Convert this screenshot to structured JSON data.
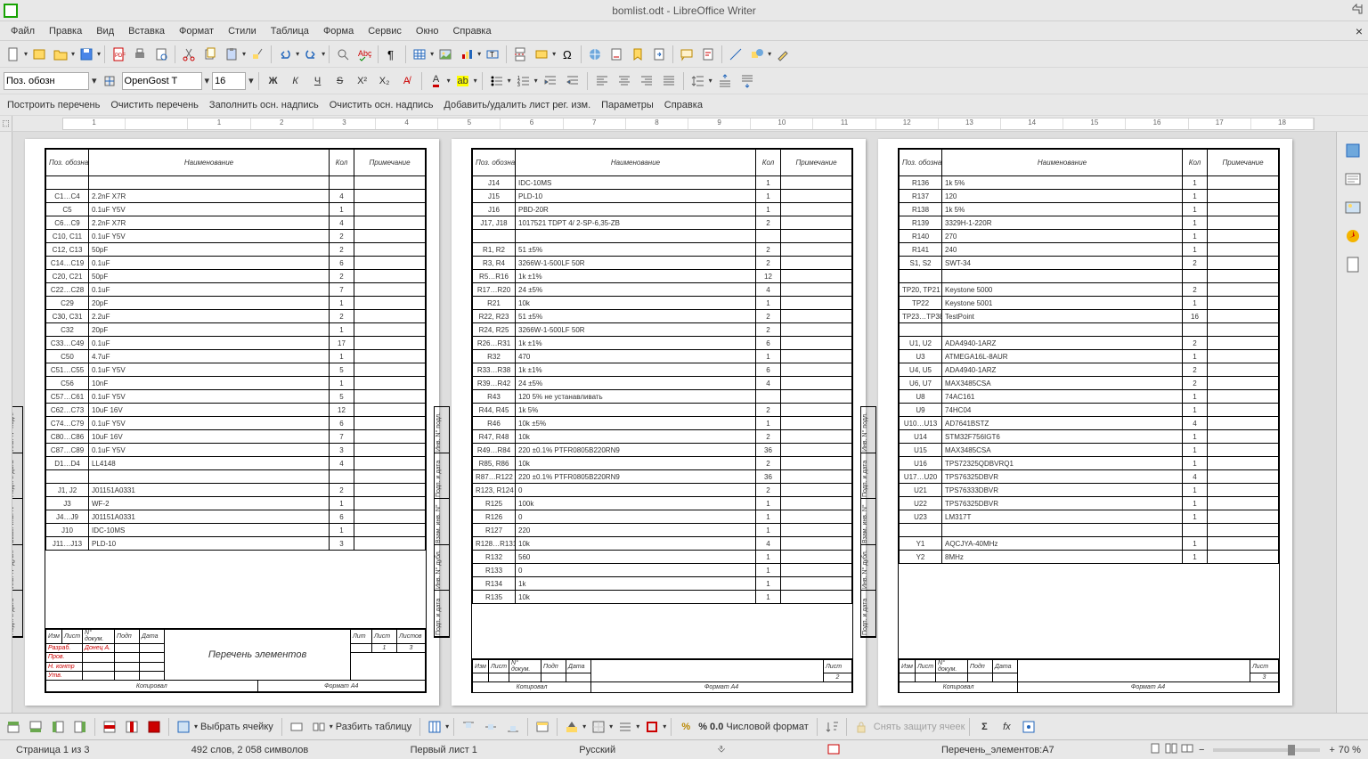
{
  "window": {
    "title": "bomlist.odt - LibreOffice Writer"
  },
  "menu": [
    "Файл",
    "Правка",
    "Вид",
    "Вставка",
    "Формат",
    "Стили",
    "Таблица",
    "Форма",
    "Сервис",
    "Окно",
    "Справка"
  ],
  "fmt": {
    "paraStyle": "Поз. обозн",
    "font": "OpenGost T",
    "size": "16"
  },
  "custom": [
    "Построить перечень",
    "Очистить перечень",
    "Заполнить осн. надпись",
    "Очистить осн. надпись",
    "Добавить/удалить лист рег. изм.",
    "Параметры",
    "Справка"
  ],
  "ruler": [
    "1",
    "",
    "1",
    "2",
    "3",
    "4",
    "5",
    "6",
    "7",
    "8",
    "9",
    "10",
    "11",
    "12",
    "13",
    "14",
    "15",
    "16",
    "17",
    "18"
  ],
  "headers": {
    "pos": "Поз. обозна-чение",
    "name": "Наименование",
    "qty": "Кол",
    "note": "Примечание"
  },
  "page1": [
    [
      "",
      "",
      "",
      ""
    ],
    [
      "C1…C4",
      "2.2nF X7R",
      "4",
      ""
    ],
    [
      "C5",
      "0.1uF Y5V",
      "1",
      ""
    ],
    [
      "C6…C9",
      "2.2nF X7R",
      "4",
      ""
    ],
    [
      "C10, C11",
      "0.1uF Y5V",
      "2",
      ""
    ],
    [
      "C12, C13",
      "50pF",
      "2",
      ""
    ],
    [
      "C14…C19",
      "0.1uF",
      "6",
      ""
    ],
    [
      "C20, C21",
      "50pF",
      "2",
      ""
    ],
    [
      "C22…C28",
      "0.1uF",
      "7",
      ""
    ],
    [
      "C29",
      "20pF",
      "1",
      ""
    ],
    [
      "C30, C31",
      "2.2uF",
      "2",
      ""
    ],
    [
      "C32",
      "20pF",
      "1",
      ""
    ],
    [
      "C33…C49",
      "0.1uF",
      "17",
      ""
    ],
    [
      "C50",
      "4.7uF",
      "1",
      ""
    ],
    [
      "C51…C55",
      "0.1uF Y5V",
      "5",
      ""
    ],
    [
      "C56",
      "10nF",
      "1",
      ""
    ],
    [
      "C57…C61",
      "0.1uF Y5V",
      "5",
      ""
    ],
    [
      "C62…C73",
      "10uF 16V",
      "12",
      ""
    ],
    [
      "C74…C79",
      "0.1uF Y5V",
      "6",
      ""
    ],
    [
      "C80…C86",
      "10uF 16V",
      "7",
      ""
    ],
    [
      "C87…C89",
      "0.1uF Y5V",
      "3",
      ""
    ],
    [
      "D1…D4",
      "LL4148",
      "4",
      ""
    ],
    [
      "",
      "",
      "",
      ""
    ],
    [
      "J1, J2",
      "J01151A0331",
      "2",
      ""
    ],
    [
      "J3",
      "WF-2",
      "1",
      ""
    ],
    [
      "J4…J9",
      "J01151A0331",
      "6",
      ""
    ],
    [
      "J10",
      "IDC-10MS",
      "1",
      ""
    ],
    [
      "J11…J13",
      "PLD-10",
      "3",
      ""
    ]
  ],
  "page2": [
    [
      "J14",
      "IDC-10MS",
      "1",
      ""
    ],
    [
      "J15",
      "PLD-10",
      "1",
      ""
    ],
    [
      "J16",
      "PBD-20R",
      "1",
      ""
    ],
    [
      "J17, J18",
      "1017521 TDPT 4/ 2-SP-6,35-ZB",
      "2",
      ""
    ],
    [
      "",
      "",
      "",
      ""
    ],
    [
      "R1, R2",
      "51 ±5%",
      "2",
      ""
    ],
    [
      "R3, R4",
      "3266W-1-500LF 50R",
      "2",
      ""
    ],
    [
      "R5…R16",
      "1k ±1%",
      "12",
      ""
    ],
    [
      "R17…R20",
      "24 ±5%",
      "4",
      ""
    ],
    [
      "R21",
      "10k",
      "1",
      ""
    ],
    [
      "R22, R23",
      "51 ±5%",
      "2",
      ""
    ],
    [
      "R24, R25",
      "3266W-1-500LF 50R",
      "2",
      ""
    ],
    [
      "R26…R31",
      "1k ±1%",
      "6",
      ""
    ],
    [
      "R32",
      "470",
      "1",
      ""
    ],
    [
      "R33…R38",
      "1k ±1%",
      "6",
      ""
    ],
    [
      "R39…R42",
      "24 ±5%",
      "4",
      ""
    ],
    [
      "R43",
      "120 5% не устанавливать",
      "",
      ""
    ],
    [
      "R44, R45",
      "1k 5%",
      "2",
      ""
    ],
    [
      "R46",
      "10k ±5%",
      "1",
      ""
    ],
    [
      "R47, R48",
      "10k",
      "2",
      ""
    ],
    [
      "R49…R84",
      "220 ±0.1% PTFR0805B220RN9",
      "36",
      ""
    ],
    [
      "R85, R86",
      "10k",
      "2",
      ""
    ],
    [
      "R87…R122",
      "220 ±0.1% PTFR0805B220RN9",
      "36",
      ""
    ],
    [
      "R123, R124",
      "0",
      "2",
      ""
    ],
    [
      "R125",
      "100k",
      "1",
      ""
    ],
    [
      "R126",
      "0",
      "1",
      ""
    ],
    [
      "R127",
      "220",
      "1",
      ""
    ],
    [
      "R128…R131",
      "10k",
      "4",
      ""
    ],
    [
      "R132",
      "560",
      "1",
      ""
    ],
    [
      "R133",
      "0",
      "1",
      ""
    ],
    [
      "R134",
      "1k",
      "1",
      ""
    ],
    [
      "R135",
      "10k",
      "1",
      ""
    ]
  ],
  "page3": [
    [
      "R136",
      "1k 5%",
      "1",
      ""
    ],
    [
      "R137",
      "120",
      "1",
      ""
    ],
    [
      "R138",
      "1k 5%",
      "1",
      ""
    ],
    [
      "R139",
      "3329H-1-220R",
      "1",
      ""
    ],
    [
      "R140",
      "270",
      "1",
      ""
    ],
    [
      "R141",
      "240",
      "1",
      ""
    ],
    [
      "S1, S2",
      "SWT-34",
      "2",
      ""
    ],
    [
      "",
      "",
      "",
      ""
    ],
    [
      "TP20, TP21",
      "Keystone 5000",
      "2",
      ""
    ],
    [
      "TP22",
      "Keystone 5001",
      "1",
      ""
    ],
    [
      "TP23…TP38",
      "TestPoint",
      "16",
      ""
    ],
    [
      "",
      "",
      "",
      ""
    ],
    [
      "U1, U2",
      "ADA4940-1ARZ",
      "2",
      ""
    ],
    [
      "U3",
      "ATMEGA16L-8AUR",
      "1",
      ""
    ],
    [
      "U4, U5",
      "ADA4940-1ARZ",
      "2",
      ""
    ],
    [
      "U6, U7",
      "MAX3485CSA",
      "2",
      ""
    ],
    [
      "U8",
      "74AC161",
      "1",
      ""
    ],
    [
      "U9",
      "74HC04",
      "1",
      ""
    ],
    [
      "U10…U13",
      "AD7641BSTZ",
      "4",
      ""
    ],
    [
      "U14",
      "STM32F756IGT6",
      "1",
      ""
    ],
    [
      "U15",
      "MAX3485CSA",
      "1",
      ""
    ],
    [
      "U16",
      "TPS72325QDBVRQ1",
      "1",
      ""
    ],
    [
      "U17…U20",
      "TPS76325DBVR",
      "4",
      ""
    ],
    [
      "U21",
      "TPS76333DBVR",
      "1",
      ""
    ],
    [
      "U22",
      "TPS76325DBVR",
      "1",
      ""
    ],
    [
      "U23",
      "LM317T",
      "1",
      ""
    ],
    [
      "",
      "",
      "",
      ""
    ],
    [
      "Y1",
      "AQCJYA-40MHz",
      "1",
      ""
    ],
    [
      "Y2",
      "8MHz",
      "1",
      ""
    ]
  ],
  "stamp1": {
    "title": "Перечень элементов",
    "copied": "Копировал",
    "format": "Формат А4",
    "razrab": "Разраб.",
    "prov": "Пров.",
    "nkontr": "Н. контр",
    "utv": "Утв.",
    "name": "Донец А.",
    "izm": "Изм",
    "list": "Лист",
    "ndoc": "N° докум.",
    "podp": "Подп",
    "data": "Дата",
    "lit": "Лит",
    "sheet": "Лист",
    "sheets": "Листов",
    "sheetN": "1",
    "sheetsN": "3"
  },
  "stamp2": {
    "copied": "Копировал",
    "format": "Формат А4",
    "sheet": "Лист",
    "sheetN": "2"
  },
  "stamp3": {
    "copied": "Копировал",
    "format": "Формат А4",
    "sheet": "Лист",
    "sheetN": "3"
  },
  "sideLabels": [
    "Подп. и дата",
    "Инв. N° дубл.",
    "Взам. инв. N°",
    "Подп. и дата",
    "Инв. N° подл."
  ],
  "bottom": {
    "select": "Выбрать ячейку",
    "split": "Разбить таблицу",
    "numfmt": "Числовой формат",
    "unprotect": "Снять защиту ячеек"
  },
  "status": {
    "page": "Страница 1 из 3",
    "words": "492 слов, 2 058 символов",
    "style": "Первый лист 1",
    "lang": "Русский",
    "doc": "Перечень_элементов:A7",
    "zoom": "70 %",
    "numpct": "% 0.0"
  }
}
